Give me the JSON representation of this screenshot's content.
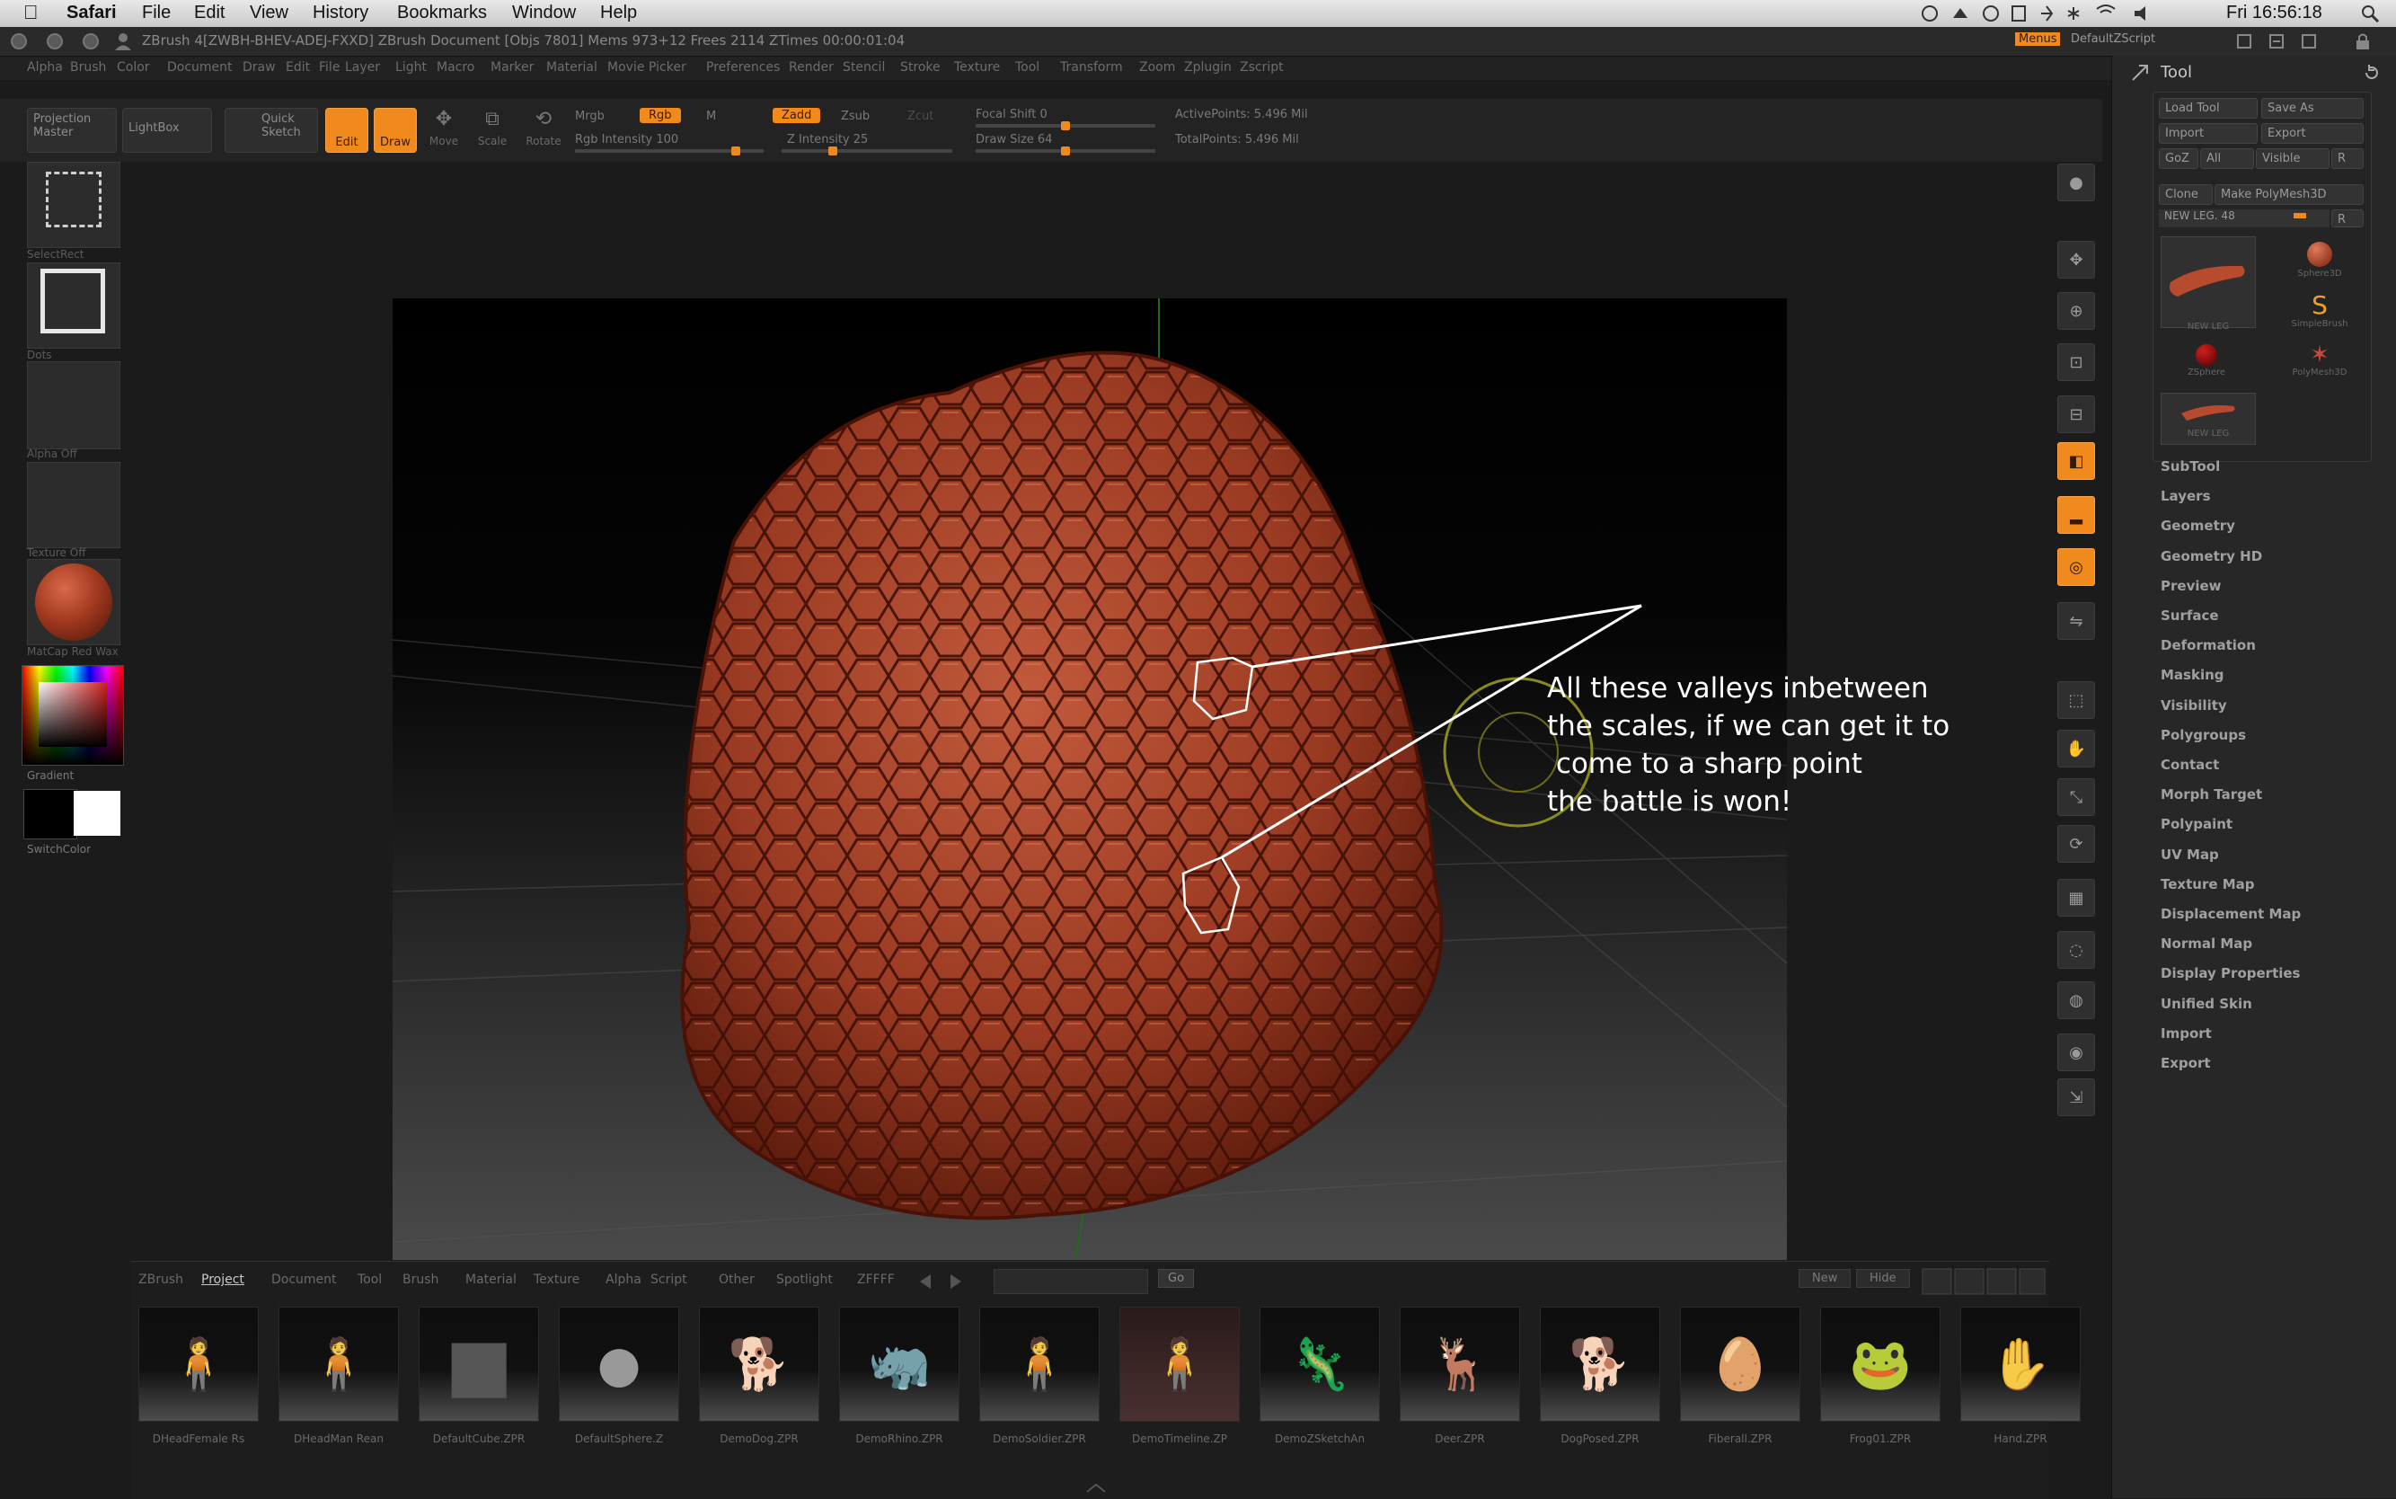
{
  "menubar": {
    "apple": "",
    "app": "Safari",
    "items": [
      "File",
      "Edit",
      "View",
      "History",
      "Bookmarks",
      "Window",
      "Help"
    ],
    "clock": "Fri 16:56:18"
  },
  "titlebar": {
    "text": "ZBrush 4[ZWBH-BHEV-ADEJ-FXXD]    ZBrush Document    [Objs 7801] Mems 973+12 Frees 2114 ZTimes 00:00:01:04",
    "menu_btn": "Menus",
    "script": "DefaultZScript"
  },
  "menus": [
    "Alpha",
    "Brush",
    "Color",
    "Document",
    "Draw",
    "Edit",
    "File",
    "Layer",
    "Light",
    "Macro",
    "Marker",
    "Material",
    "Movie",
    "Picker",
    "Preferences",
    "Render",
    "Stencil",
    "Stroke",
    "Texture",
    "Tool",
    "Transform",
    "Zoom",
    "Zplugin",
    "Zscript"
  ],
  "toolbar": {
    "projection_master": "Projection Master",
    "lightbox": "LightBox",
    "quick_sketch": "Quick Sketch",
    "edit": "Edit",
    "draw": "Draw",
    "move": "Move",
    "scale": "Scale",
    "rotate": "Rotate",
    "mrgb": "Mrgb",
    "rgb": "Rgb",
    "m": "M",
    "rgb_intensity": "Rgb Intensity 100",
    "zadd": "Zadd",
    "zsub": "Zsub",
    "zcut": "Zcut",
    "z_intensity": "Z Intensity 25",
    "focal_shift": "Focal Shift 0",
    "draw_size": "Draw Size 64",
    "active_points": "ActivePoints: 5.496 Mil",
    "total_points": "TotalPoints: 5.496 Mil",
    "rgb_level": 0.85,
    "z_level": 0.3,
    "focal_level": 0.5,
    "drawsize_level": 0.5
  },
  "left_shelf": {
    "select_rect": "SelectRect",
    "dots": "Dots",
    "alpha": "Alpha Off",
    "texture": "Texture Off",
    "material": "MatCap Red Wax",
    "gradient": "Gradient",
    "switch_color": "SwitchColor"
  },
  "right_shelf": [
    "BPR",
    "SPix",
    "Scroll",
    "Zoom",
    "Actual",
    "AAHalf",
    "Persp",
    "Floor",
    "Local",
    "L.Sym",
    "XYZ",
    "Frame",
    "Move",
    "Scale",
    "Rotate",
    "PolyF",
    "Transp",
    "Ghost",
    "Solo",
    "Xpose"
  ],
  "tool_panel": {
    "title": "Tool",
    "load_tool": "Load Tool",
    "save_as": "Save As",
    "import": "Import",
    "export": "Export",
    "goz": "GoZ",
    "all": "All",
    "visible": "Visible",
    "r": "R",
    "clone": "Clone",
    "make_polymesh": "Make PolyMesh3D",
    "current_tool": "NEW LEG. 48",
    "thumbs": [
      "NEW LEG",
      "Sphere3D",
      "SimpleBrush",
      "ZSphere",
      "PolyMesh3D",
      "NEW LEG"
    ],
    "sections": [
      "SubTool",
      "Layers",
      "Geometry",
      "Geometry HD",
      "Preview",
      "Surface",
      "Deformation",
      "Masking",
      "Visibility",
      "Polygroups",
      "Contact",
      "Morph Target",
      "Polypaint",
      "UV Map",
      "Texture Map",
      "Displacement Map",
      "Normal Map",
      "Display Properties",
      "Unified Skin",
      "Import",
      "Export"
    ]
  },
  "lightbox": {
    "tabs": [
      "ZBrush",
      "Project",
      "Document",
      "Tool",
      "Brush",
      "Material",
      "Texture",
      "Alpha",
      "Script",
      "Other",
      "Spotlight",
      "ZFFFF"
    ],
    "go": "Go",
    "new": "New",
    "hide": "Hide",
    "items": [
      "DHeadFemale Rs",
      "DHeadMan Rean",
      "DefaultCube.ZPR",
      "DefaultSphere.Z",
      "DemoDog.ZPR",
      "DemoRhino.ZPR",
      "DemoSoldier.ZPR",
      "DemoTimeline.ZP",
      "DemoZSketchAn",
      "Deer.ZPR",
      "DogPosed.ZPR",
      "Fiberall.ZPR",
      "Frog01.ZPR",
      "Hand.ZPR"
    ]
  },
  "annotation": "All these valleys inbetween\nthe scales, if we can get it to\n come to a sharp point\nthe battle is won!"
}
